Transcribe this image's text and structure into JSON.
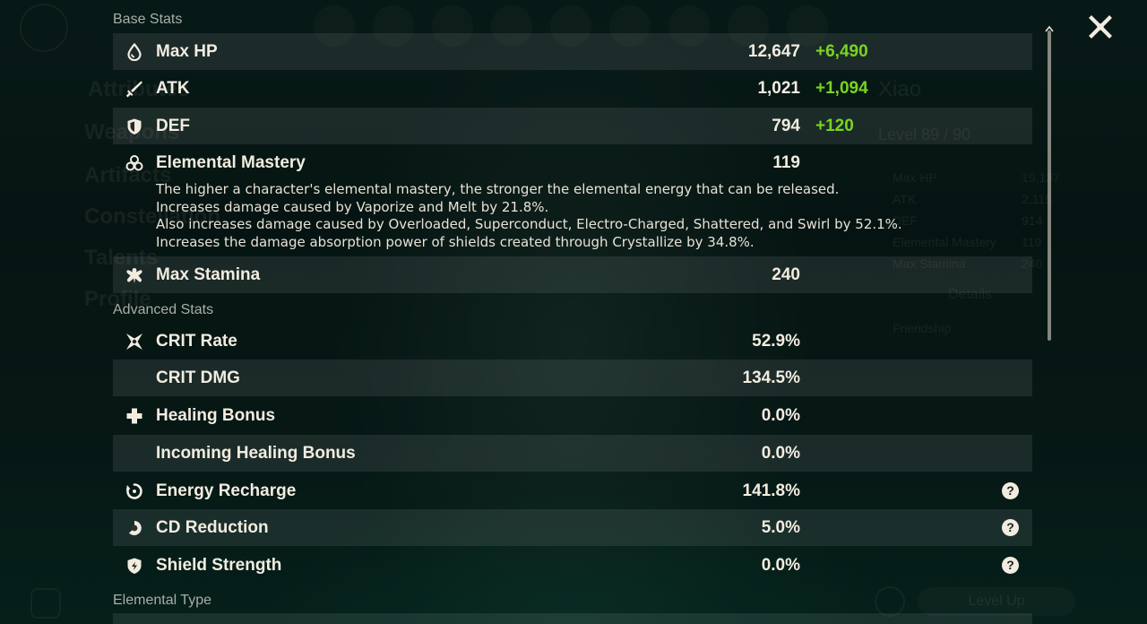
{
  "background_ghost": {
    "sidebar": [
      "Attributes",
      "Weapons",
      "Artifacts",
      "Constellation",
      "Talents",
      "Profile"
    ],
    "char_name": "Xiao",
    "char_level": "Level 89 / 90",
    "mini_stats": [
      {
        "label": "Max HP",
        "value": "19,137"
      },
      {
        "label": "ATK",
        "value": "2,115"
      },
      {
        "label": "DEF",
        "value": "914"
      },
      {
        "label": "Elemental Mastery",
        "value": "119"
      },
      {
        "label": "Max Stamina",
        "value": "240"
      }
    ],
    "details_label": "Details",
    "friendship_label": "Friendship",
    "level_up_label": "Level Up"
  },
  "base_stats": {
    "title": "Base Stats",
    "rows": [
      {
        "icon": "hp-drop-icon",
        "label": "Max HP",
        "value": "12,647",
        "bonus": "+6,490"
      },
      {
        "icon": "atk-sword-icon",
        "label": "ATK",
        "value": "1,021",
        "bonus": "+1,094"
      },
      {
        "icon": "def-shield-icon",
        "label": "DEF",
        "value": "794",
        "bonus": "+120"
      },
      {
        "icon": "elemental-mastery-icon",
        "label": "Elemental Mastery",
        "value": "119"
      },
      {
        "icon": "stamina-icon",
        "label": "Max Stamina",
        "value": "240"
      }
    ],
    "em_description": [
      "The higher a character's elemental mastery, the stronger the elemental energy that can be released.",
      "Increases damage caused by Vaporize and Melt by 21.8%.",
      "Also increases damage caused by Overloaded, Superconduct, Electro-Charged, Shattered, and Swirl by 52.1%.",
      "Increases the damage absorption power of shields created through Crystallize by 34.8%."
    ]
  },
  "advanced_stats": {
    "title": "Advanced Stats",
    "rows": [
      {
        "icon": "crit-rate-icon",
        "label": "CRIT Rate",
        "value": "52.9%"
      },
      {
        "icon": "",
        "label": "CRIT DMG",
        "value": "134.5%"
      },
      {
        "icon": "healing-cross-icon",
        "label": "Healing Bonus",
        "value": "0.0%"
      },
      {
        "icon": "",
        "label": "Incoming Healing Bonus",
        "value": "0.0%"
      },
      {
        "icon": "energy-recharge-icon",
        "label": "Energy Recharge",
        "value": "141.8%",
        "help": "?"
      },
      {
        "icon": "cd-reduction-icon",
        "label": "CD Reduction",
        "value": "5.0%",
        "help": "?"
      },
      {
        "icon": "shield-strength-icon",
        "label": "Shield Strength",
        "value": "0.0%",
        "help": "?"
      }
    ]
  },
  "elemental_type": {
    "title": "Elemental Type"
  },
  "colors": {
    "bonus_green": "#7ad420",
    "row_shade": "rgba(255,255,255,0.085)",
    "text": "#f2ece0",
    "section_title": "#a9aea7"
  }
}
